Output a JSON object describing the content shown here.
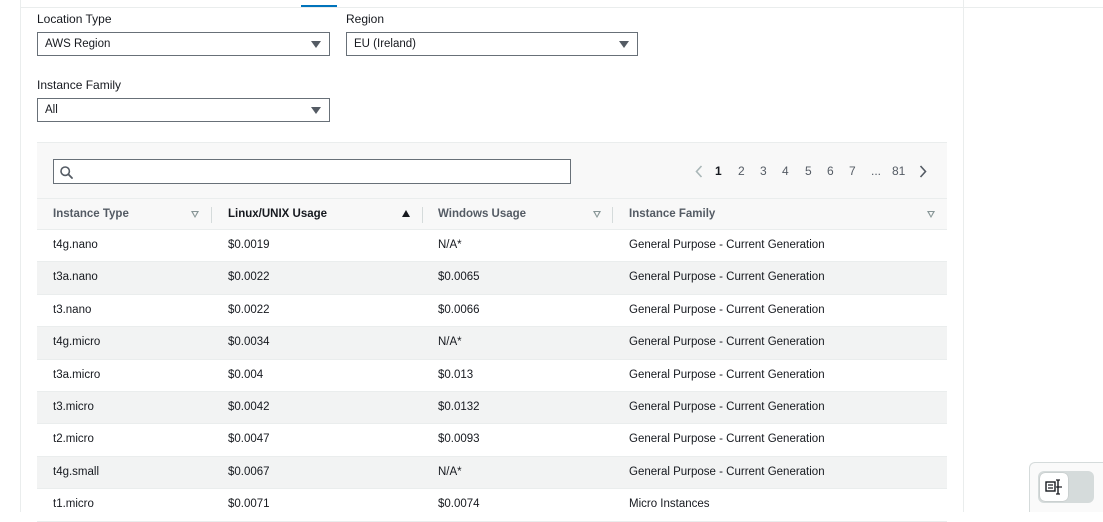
{
  "filters": {
    "location_type": {
      "label": "Location Type",
      "value": "AWS Region"
    },
    "region": {
      "label": "Region",
      "value": "EU (Ireland)"
    },
    "instance_family": {
      "label": "Instance Family",
      "value": "All"
    }
  },
  "search": {
    "placeholder": ""
  },
  "pagination": {
    "pages": [
      "1",
      "2",
      "3",
      "4",
      "5",
      "6",
      "7",
      "...",
      "81"
    ],
    "current": "1"
  },
  "table": {
    "columns": [
      "Instance Type",
      "Linux/UNIX Usage",
      "Windows Usage",
      "Instance Family"
    ],
    "sorted_column": "Linux/UNIX Usage",
    "sort_direction": "ascending",
    "rows": [
      [
        "t4g.nano",
        "$0.0019",
        "N/A*",
        "General Purpose - Current Generation"
      ],
      [
        "t3a.nano",
        "$0.0022",
        "$0.0065",
        "General Purpose - Current Generation"
      ],
      [
        "t3.nano",
        "$0.0022",
        "$0.0066",
        "General Purpose - Current Generation"
      ],
      [
        "t4g.micro",
        "$0.0034",
        "N/A*",
        "General Purpose - Current Generation"
      ],
      [
        "t3a.micro",
        "$0.004",
        "$0.013",
        "General Purpose - Current Generation"
      ],
      [
        "t3.micro",
        "$0.0042",
        "$0.0132",
        "General Purpose - Current Generation"
      ],
      [
        "t2.micro",
        "$0.0047",
        "$0.0093",
        "General Purpose - Current Generation"
      ],
      [
        "t4g.small",
        "$0.0067",
        "N/A*",
        "General Purpose - Current Generation"
      ],
      [
        "t1.micro",
        "$0.0071",
        "$0.0074",
        "Micro Instances"
      ]
    ]
  },
  "colors": {
    "border": "#687078",
    "header_text": "#545b64",
    "row_stripe": "#f2f3f3",
    "accent": "#0073bb"
  }
}
